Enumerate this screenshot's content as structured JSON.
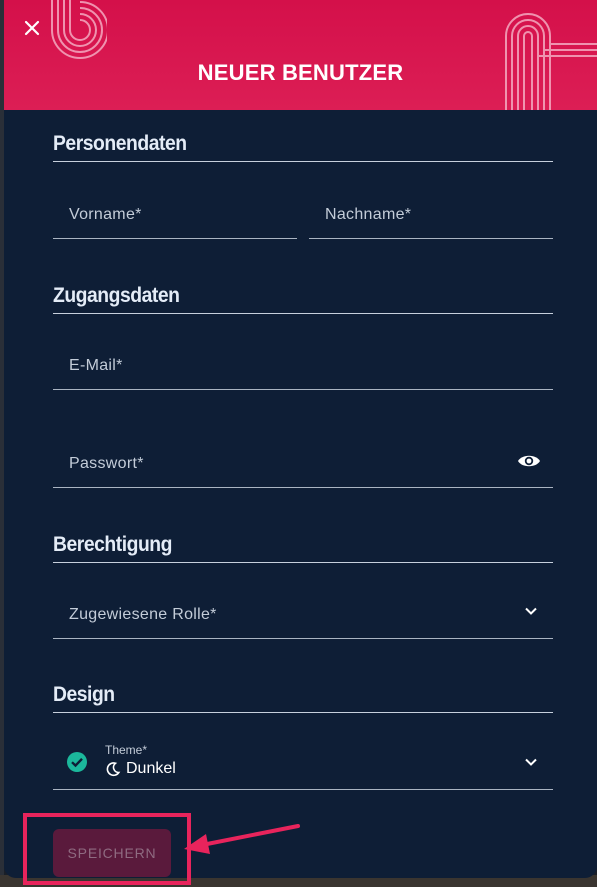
{
  "dialog": {
    "title": "NEUER BENUTZER",
    "close_icon": "close-icon",
    "header_color": "#d4104a",
    "background_color": "#0e1e36"
  },
  "sections": {
    "personal": {
      "title": "Personendaten",
      "first_name_label": "Vorname*",
      "last_name_label": "Nachname*"
    },
    "access": {
      "title": "Zugangsdaten",
      "email_label": "E-Mail*",
      "password_label": "Passwort*",
      "password_toggle_icon": "eye-icon"
    },
    "permission": {
      "title": "Berechtigung",
      "role_label": "Zugewiesene Rolle*",
      "role_dropdown_icon": "chevron-down-icon"
    },
    "design": {
      "title": "Design",
      "theme_label": "Theme*",
      "theme_value": "Dunkel",
      "theme_status_icon": "check-circle-icon",
      "theme_value_icon": "moon-icon",
      "theme_dropdown_icon": "chevron-down-icon"
    }
  },
  "actions": {
    "save_label": "SPEICHERN",
    "save_disabled": true
  },
  "annotation": {
    "highlight_color": "#e8245c"
  }
}
